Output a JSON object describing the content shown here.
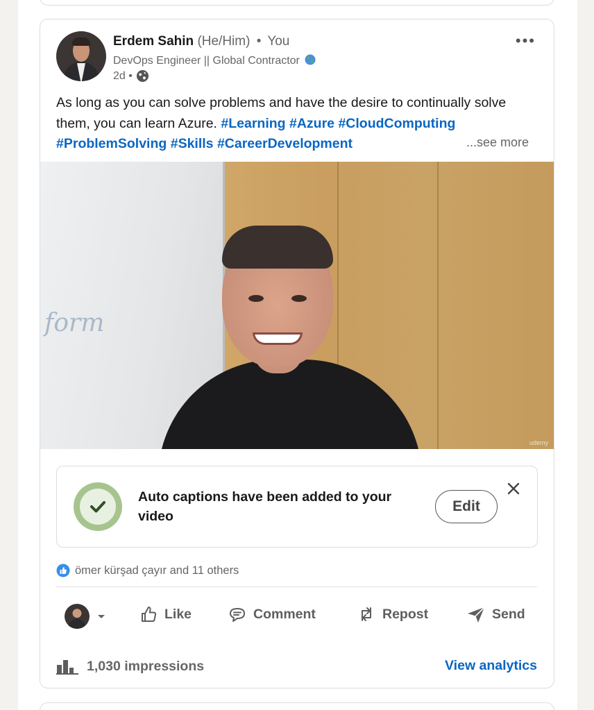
{
  "post": {
    "author": {
      "name": "Erdem Sahin",
      "pronouns": "(He/Him)",
      "separator": "•",
      "relation": "You",
      "headline": "DevOps Engineer || Global Contractor",
      "time": "2d •"
    },
    "more_menu_label": "•••",
    "text": {
      "body": "As long as you can solve problems and have the desire to continually solve them, you can learn Azure.",
      "hashtags": [
        "#Learning",
        "#Azure",
        "#CloudComputing",
        "#ProblemSolving",
        "#Skills",
        "#CareerDevelopment"
      ],
      "see_more": "...see more"
    },
    "video": {
      "watermark": "udemy"
    },
    "caption_notice": {
      "message": "Auto captions have been added to your video",
      "edit_label": "Edit",
      "status_color": "#a7c48f"
    },
    "reactions": {
      "summary": "ömer kürşad çayır and 11 others"
    },
    "actions": [
      {
        "label": "Like",
        "icon": "thumbs-up-icon"
      },
      {
        "label": "Comment",
        "icon": "comment-icon"
      },
      {
        "label": "Repost",
        "icon": "repost-icon"
      },
      {
        "label": "Send",
        "icon": "send-icon"
      }
    ],
    "analytics": {
      "impressions": "1,030 impressions",
      "view_label": "View analytics"
    }
  },
  "colors": {
    "link_blue": "#0a66c2",
    "text_primary": "#191919",
    "text_secondary": "#666666"
  }
}
